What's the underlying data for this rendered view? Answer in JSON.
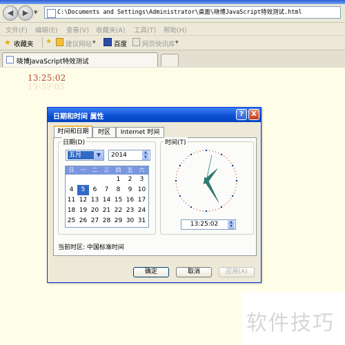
{
  "browser": {
    "address": "C:\\Documents and Settings\\Administrator\\桌面\\晓博JavaScript特效测试.html",
    "menu": [
      "文件(F)",
      "编辑(E)",
      "查看(V)",
      "收藏夹(A)",
      "工具(T)",
      "帮助(H)"
    ],
    "favorites_label": "收藏夹",
    "suggested_sites": "建议网站",
    "baidu": "百度",
    "web_slices": "网页快讯库",
    "tab_title": "晓博JavaScript特效测试"
  },
  "page": {
    "clock_text": "13:25:02"
  },
  "dialog": {
    "title": "日期和时间 属性",
    "help": "?",
    "close": "X",
    "tabs": [
      "时间和日期",
      "时区",
      "Internet 时间"
    ],
    "date_group": "日期(D)",
    "time_group": "时间(T)",
    "month": "五月",
    "year": "2014",
    "weekdays": [
      "日",
      "一",
      "二",
      "三",
      "四",
      "五",
      "六"
    ],
    "days": [
      [
        "",
        "",
        "",
        "",
        "1",
        "2",
        "3"
      ],
      [
        "4",
        "5",
        "6",
        "7",
        "8",
        "9",
        "10"
      ],
      [
        "11",
        "12",
        "13",
        "14",
        "15",
        "16",
        "17"
      ],
      [
        "18",
        "19",
        "20",
        "21",
        "22",
        "23",
        "24"
      ],
      [
        "25",
        "26",
        "27",
        "28",
        "29",
        "30",
        "31"
      ]
    ],
    "selected_day": "5",
    "time": "13:25:02",
    "timezone": "当前时区: 中国标准时间",
    "ok": "确定",
    "cancel": "取消",
    "apply": "应用(A)"
  },
  "watermark": "软件技巧",
  "colors": {
    "accent": "#316ac5",
    "page_bg": "#fefde8",
    "clock_text": "#b34a2a"
  }
}
